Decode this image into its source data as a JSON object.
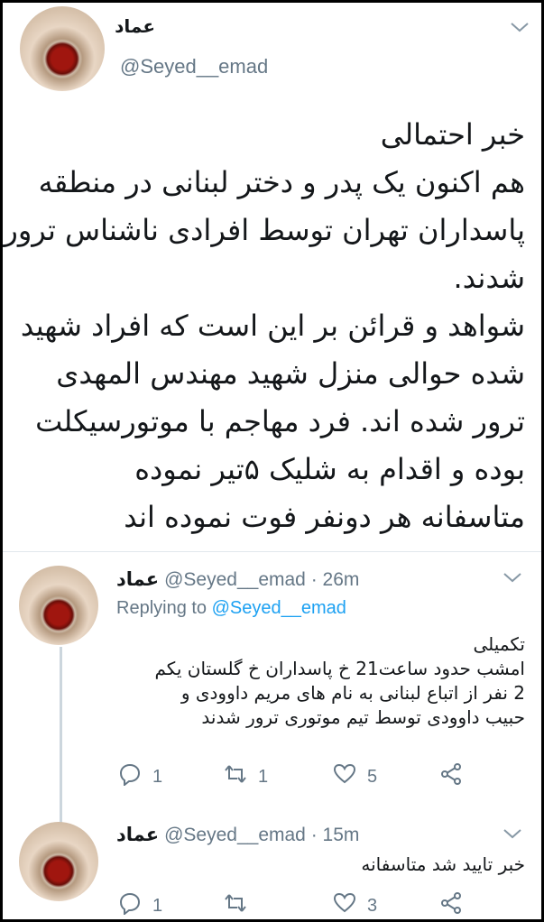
{
  "main_tweet": {
    "author_name": "عماد",
    "handle": "@Seyed__emad",
    "text_lines": [
      "خبر احتمالی",
      "هم اکنون یک پدر و دختر لبنانی در منطقه",
      "پاسداران تهران توسط افرادی ناشناس ترور",
      "شدند.",
      "شواهد و قرائن بر این است که افراد شهید",
      "شده حوالی منزل  شهید مهندس المهدی",
      "ترور شده اند. فرد مهاجم با موتورسیکلت",
      "بوده و اقدام به شلیک ۵تیر نموده",
      "متاسفانه هر دونفر فوت نموده اند"
    ]
  },
  "reply1": {
    "author_name": "عماد",
    "handle": "@Seyed__emad",
    "time": "· 26m",
    "replying_prefix": "Replying to",
    "replying_handle": "@Seyed__emad",
    "text_lines": [
      "تکمیلی",
      "امشب حدود ساعت21 خ پاسداران خ گلستان یکم",
      "2 نفر از اتباع لبنانی به نام های مریم داوودی و",
      "حبیب داوودی توسط تیم موتوری ترور شدند"
    ],
    "reply_count": "1",
    "retweet_count": "1",
    "like_count": "5"
  },
  "reply2": {
    "author_name": "عماد",
    "handle": "@Seyed__emad",
    "time": "· 15m",
    "text": "خبر تایید شد متاسفانه",
    "reply_count": "1",
    "retweet_count": "",
    "like_count": "3"
  },
  "icons": [
    "chevron-down-icon",
    "reply-icon",
    "retweet-icon",
    "like-icon",
    "share-icon"
  ],
  "colors": {
    "link": "#1da1f2",
    "secondary_text": "#657786",
    "divider": "#e1e8ed"
  }
}
